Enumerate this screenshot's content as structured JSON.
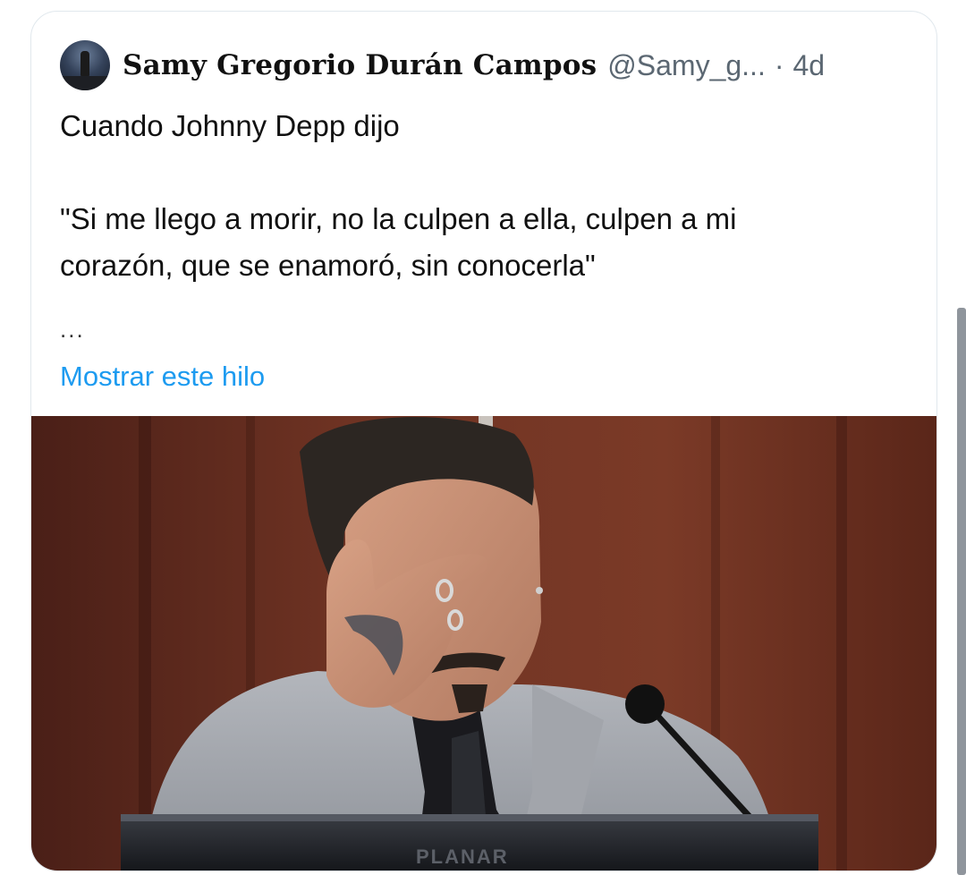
{
  "tweet": {
    "author": {
      "display_name": "Samy Gregorio Durán Campos",
      "handle": "@Samy_g...",
      "separator": "·",
      "time": "4d"
    },
    "text_line_1": "Cuando Johnny Depp dijo",
    "text_line_2": "\"Si me llego a morir, no la culpen a ella, culpen a mi",
    "text_line_3": "corazón, que se enamoró, sin conocerla\"",
    "ellipsis": "...",
    "show_thread_label": "Mostrar este hilo",
    "media": {
      "podium_text": "PLANAR"
    }
  },
  "colors": {
    "link": "#1d9bf0",
    "secondary_text": "#5b6772",
    "primary_text": "#111111"
  }
}
